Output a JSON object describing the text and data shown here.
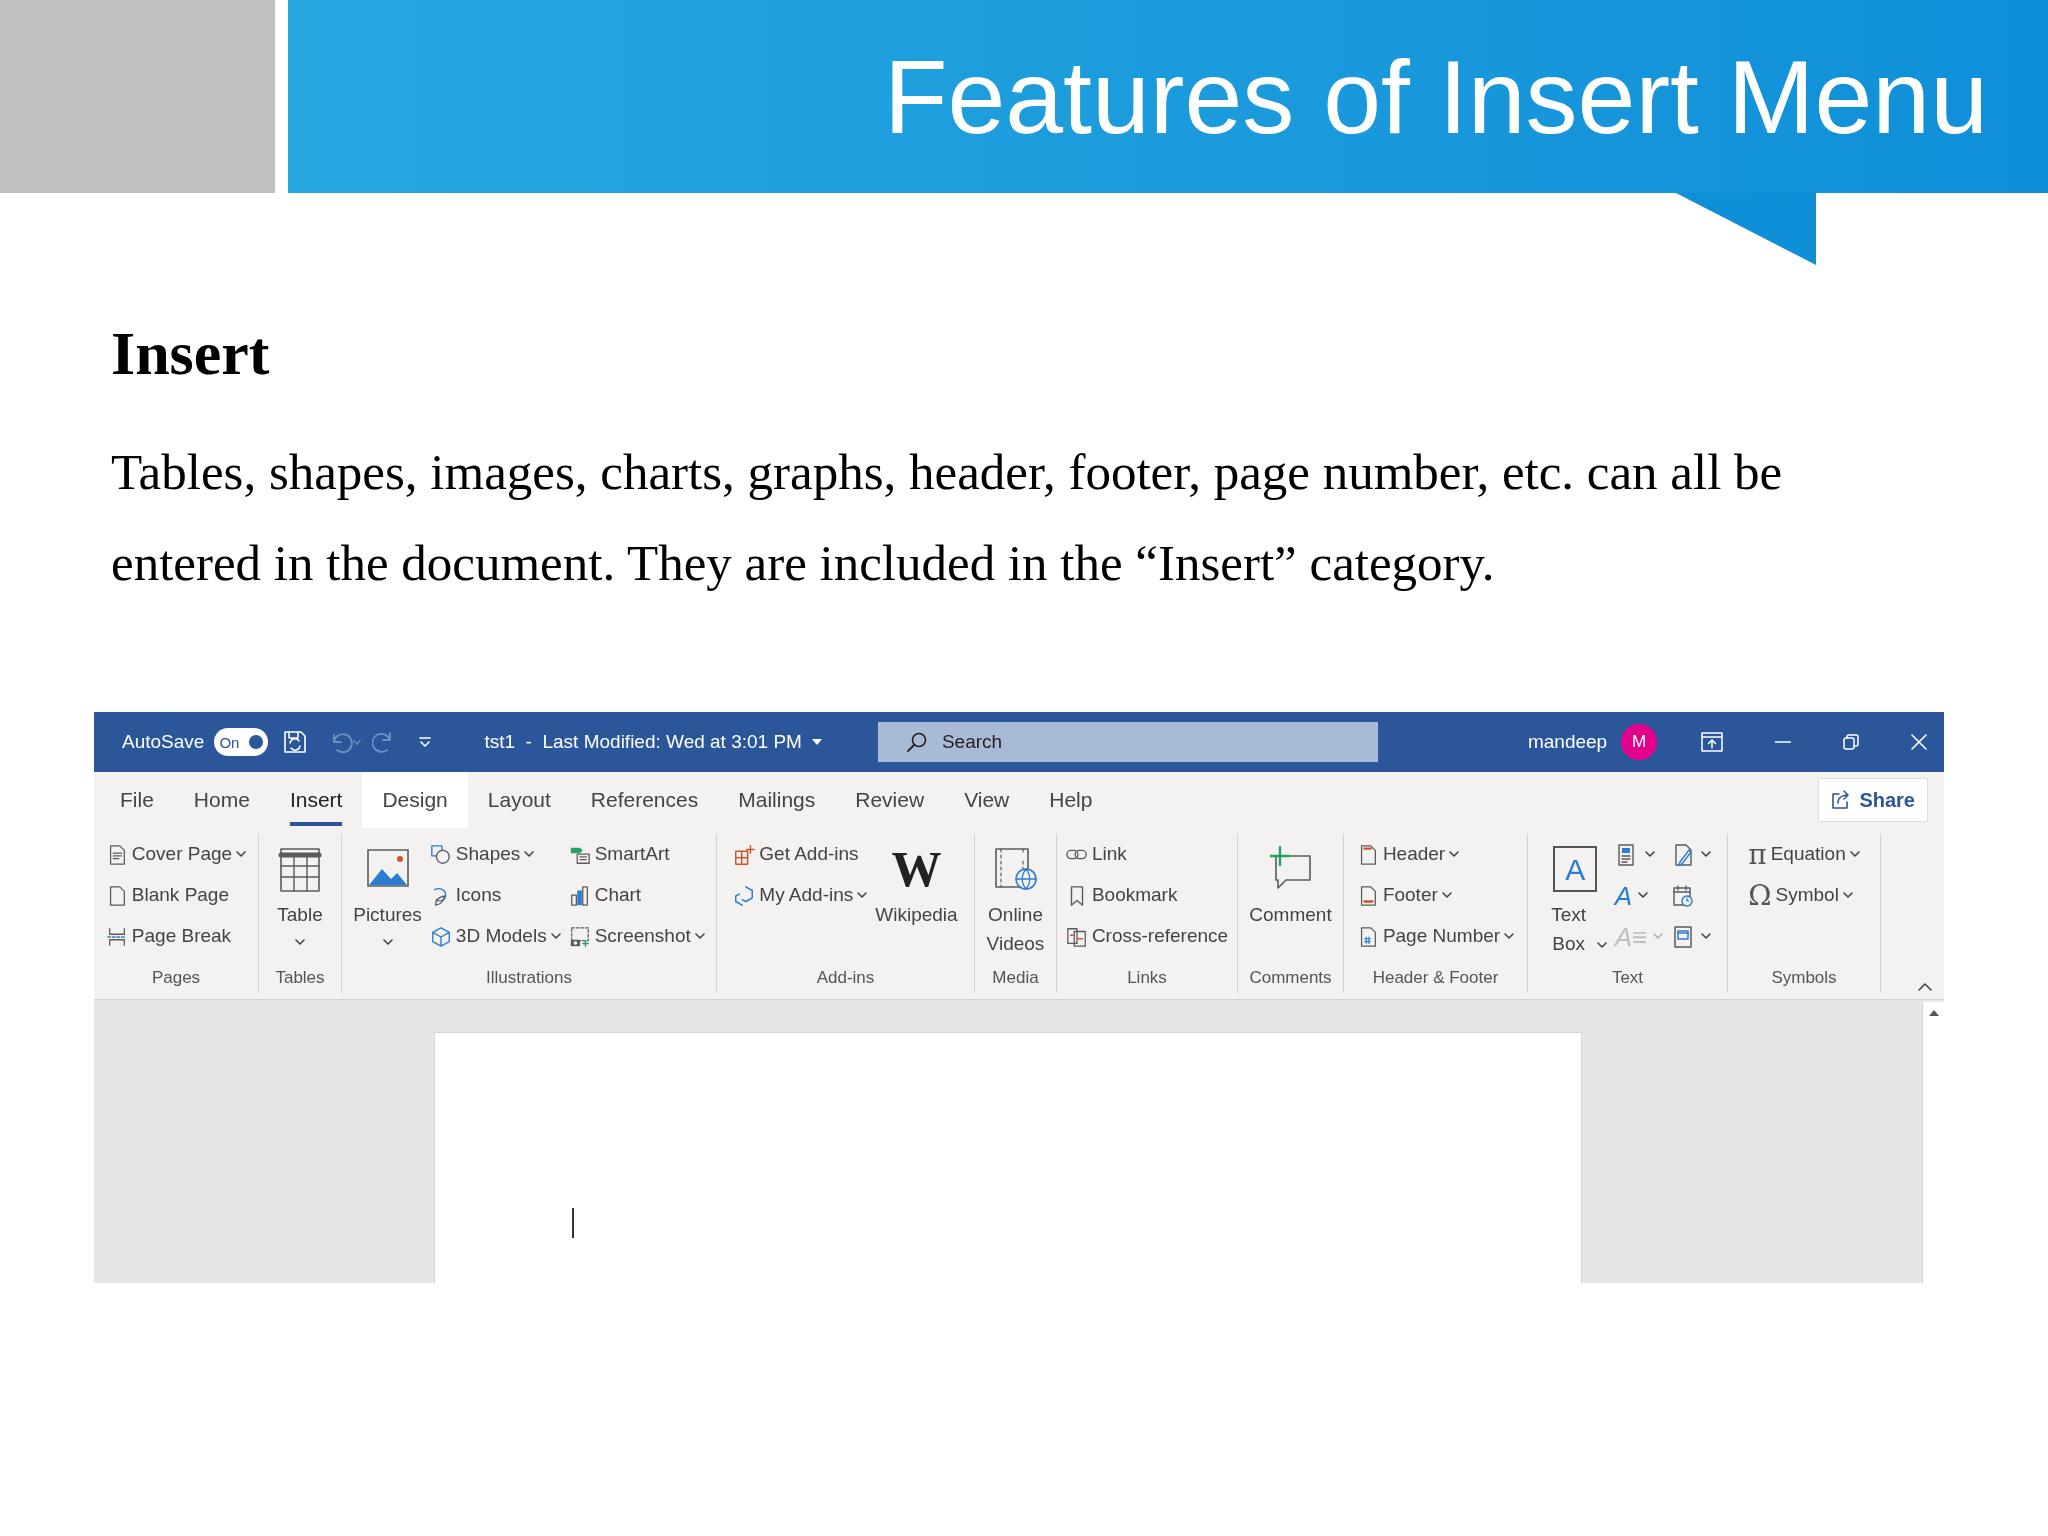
{
  "slide": {
    "title": "Features of Insert Menu",
    "heading": "Insert",
    "paragraph": "Tables, shapes, images, charts, graphs, header, footer, page number, etc. can all be entered in the document. They are included in the “Insert” category."
  },
  "word": {
    "title_bar": {
      "autosave_label": "AutoSave",
      "autosave_toggle": {
        "label": "On",
        "on": true
      },
      "document_title": "tst1  -  Last Modified: Wed at 3:01 PM",
      "search": {
        "placeholder": "Search"
      },
      "user": "mandeep",
      "avatar": "M"
    },
    "tabs": [
      {
        "label": "File",
        "selected": false,
        "hovered": false
      },
      {
        "label": "Home",
        "selected": false,
        "hovered": false
      },
      {
        "label": "Insert",
        "selected": true,
        "hovered": false
      },
      {
        "label": "Design",
        "selected": false,
        "hovered": true
      },
      {
        "label": "Layout",
        "selected": false,
        "hovered": false
      },
      {
        "label": "References",
        "selected": false,
        "hovered": false
      },
      {
        "label": "Mailings",
        "selected": false,
        "hovered": false
      },
      {
        "label": "Review",
        "selected": false,
        "hovered": false
      },
      {
        "label": "View",
        "selected": false,
        "hovered": false
      },
      {
        "label": "Help",
        "selected": false,
        "hovered": false
      }
    ],
    "share_button": "Share",
    "groups": [
      {
        "label": "Pages",
        "items": [
          {
            "kind": "stack",
            "commands": [
              {
                "kind": "small",
                "label": "Cover Page",
                "dropdown": true
              },
              {
                "kind": "small",
                "label": "Blank Page",
                "dropdown": false
              },
              {
                "kind": "small",
                "label": "Page Break",
                "dropdown": false
              }
            ]
          }
        ]
      },
      {
        "label": "Tables",
        "items": [
          {
            "kind": "large",
            "label": "Table",
            "dropdown": true
          }
        ]
      },
      {
        "label": "Illustrations",
        "items": [
          {
            "kind": "large",
            "label": "Pictures",
            "dropdown": true
          },
          {
            "kind": "stack",
            "commands": [
              {
                "kind": "small",
                "label": "Shapes",
                "dropdown": true
              },
              {
                "kind": "small",
                "label": "Icons",
                "dropdown": false
              },
              {
                "kind": "small",
                "label": "3D Models",
                "dropdown": true
              }
            ]
          },
          {
            "kind": "stack",
            "commands": [
              {
                "kind": "small",
                "label": "SmartArt",
                "dropdown": false
              },
              {
                "kind": "small",
                "label": "Chart",
                "dropdown": false
              },
              {
                "kind": "small",
                "label": "Screenshot",
                "dropdown": true
              }
            ]
          }
        ]
      },
      {
        "label": "Add-ins",
        "items": [
          {
            "kind": "stack",
            "commands": [
              {
                "kind": "small",
                "label": "Get Add-ins",
                "dropdown": false
              },
              {
                "kind": "small",
                "label": "My Add-ins",
                "dropdown": true
              }
            ]
          },
          {
            "kind": "large",
            "label": "Wikipedia",
            "glyph": "W",
            "dropdown": false
          }
        ]
      },
      {
        "label": "Media",
        "items": [
          {
            "kind": "large",
            "label": "Online Videos",
            "dropdown": false
          }
        ]
      },
      {
        "label": "Links",
        "items": [
          {
            "kind": "stack",
            "commands": [
              {
                "kind": "small",
                "label": "Link",
                "dropdown": false
              },
              {
                "kind": "small",
                "label": "Bookmark",
                "dropdown": false
              },
              {
                "kind": "small",
                "label": "Cross-reference",
                "dropdown": false
              }
            ]
          }
        ]
      },
      {
        "label": "Comments",
        "items": [
          {
            "kind": "large",
            "label": "Comment",
            "dropdown": false
          }
        ]
      },
      {
        "label": "Header & Footer",
        "items": [
          {
            "kind": "stack",
            "commands": [
              {
                "kind": "small",
                "label": "Header",
                "dropdown": true
              },
              {
                "kind": "small",
                "label": "Footer",
                "dropdown": true
              },
              {
                "kind": "small",
                "label": "Page Number",
                "dropdown": true
              }
            ]
          }
        ]
      },
      {
        "label": "Text",
        "items": [
          {
            "kind": "large",
            "label": "Text Box",
            "glyph": "A",
            "dropdown": true
          },
          {
            "kind": "stack",
            "commands": [
              {
                "kind": "icon",
                "dropdown": true,
                "disabled": false
              },
              {
                "kind": "icon",
                "glyph": "A",
                "dropdown": true,
                "disabled": false
              },
              {
                "kind": "icon",
                "glyph": "A≡",
                "dropdown": true,
                "disabled": true
              }
            ]
          },
          {
            "kind": "stack",
            "commands": [
              {
                "kind": "icon",
                "dropdown": true,
                "disabled": false
              },
              {
                "kind": "icon",
                "dropdown": false,
                "disabled": false
              },
              {
                "kind": "icon",
                "dropdown": true,
                "disabled": false
              }
            ]
          }
        ]
      },
      {
        "label": "Symbols",
        "items": [
          {
            "kind": "stack",
            "commands": [
              {
                "kind": "small",
                "label": "Equation",
                "glyph": "π",
                "dropdown": true
              },
              {
                "kind": "small",
                "label": "Symbol",
                "glyph": "Ω",
                "dropdown": true
              }
            ]
          }
        ]
      }
    ]
  }
}
